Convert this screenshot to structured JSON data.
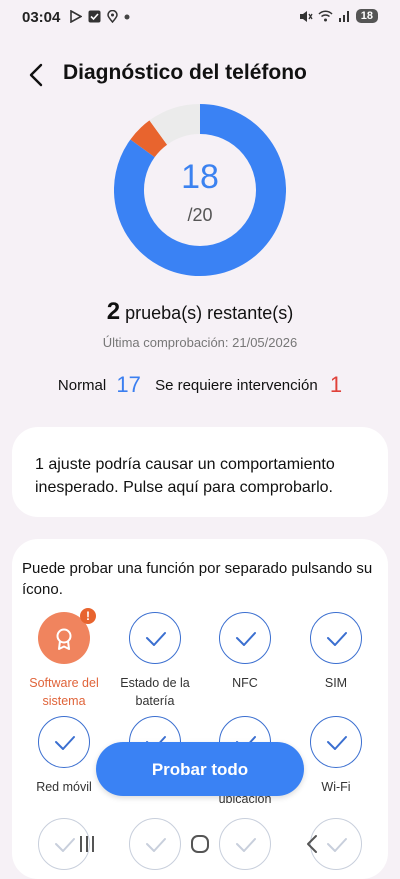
{
  "status_bar": {
    "time": "03:04",
    "battery": "18"
  },
  "header": {
    "title": "Diagnóstico del teléfono"
  },
  "score": {
    "value": "18",
    "total": "/20",
    "passed": 17,
    "issues": 1,
    "pending": 2,
    "out_of": 20
  },
  "remaining": {
    "count": "2",
    "text": "prueba(s) restante(s)"
  },
  "last_check": "Última comprobación: 21/05/2026",
  "stats": {
    "normal_label": "Normal",
    "normal_count": "17",
    "issues_label": "Se requiere intervención",
    "issues_count": "1"
  },
  "warning_card": {
    "text": "1 ajuste podría causar un comportamiento inesperado. Pulse aquí para comprobarlo."
  },
  "functions": {
    "intro": "Puede probar una función por separado pulsando su ícono.",
    "items": [
      {
        "label": "Software del sistema",
        "icon": "ribbon-icon",
        "state": "alert",
        "badge": "!"
      },
      {
        "label": "Estado de la batería",
        "icon": "check-icon",
        "state": "ok"
      },
      {
        "label": "NFC",
        "icon": "check-icon",
        "state": "ok"
      },
      {
        "label": "SIM",
        "icon": "check-icon",
        "state": "ok"
      },
      {
        "label": "Red móvil",
        "icon": "check-icon",
        "state": "ok"
      },
      {
        "label": "ubicación",
        "icon": "check-icon",
        "state": "ok"
      },
      {
        "label": "Wi-Fi",
        "icon": "check-icon",
        "state": "ok"
      }
    ]
  },
  "cta": {
    "label": "Probar todo"
  },
  "colors": {
    "accent": "#3a82f4",
    "warning": "#e8642e",
    "error": "#e0413a",
    "pending": "#ebebeb"
  }
}
